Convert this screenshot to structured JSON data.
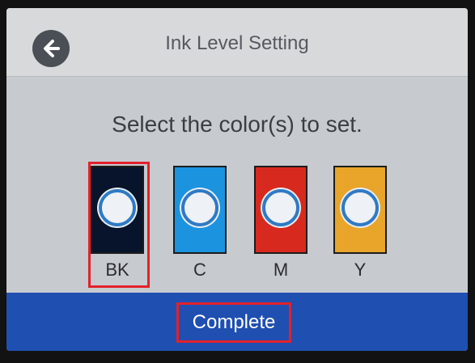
{
  "header": {
    "title": "Ink Level Setting",
    "back_icon": "arrow-left-icon"
  },
  "prompt": "Select the color(s) to set.",
  "inks": [
    {
      "label": "BK",
      "color": "#07142b",
      "selected": true
    },
    {
      "label": "C",
      "color": "#1c93df",
      "selected": false
    },
    {
      "label": "M",
      "color": "#d8291f",
      "selected": false
    },
    {
      "label": "Y",
      "color": "#e8a52a",
      "selected": false
    }
  ],
  "footer": {
    "complete_label": "Complete"
  },
  "colors": {
    "highlight": "#e3212b",
    "footer_bg": "#1f4fb1",
    "screen_bg": "#c7cbd0"
  }
}
